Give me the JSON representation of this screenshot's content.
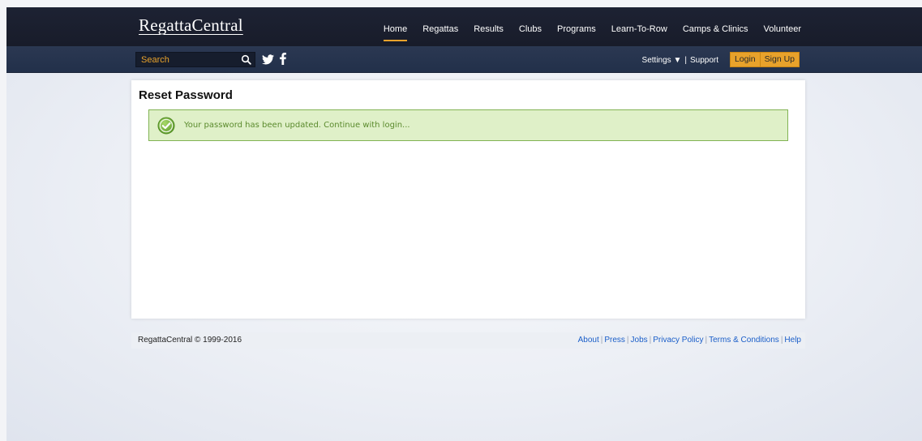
{
  "brand": {
    "logo_part1": "Regatta",
    "logo_part2": "Central"
  },
  "nav": {
    "items": [
      {
        "label": "Home",
        "active": true
      },
      {
        "label": "Regattas"
      },
      {
        "label": "Results"
      },
      {
        "label": "Clubs"
      },
      {
        "label": "Programs"
      },
      {
        "label": "Learn-To-Row"
      },
      {
        "label": "Camps & Clinics"
      },
      {
        "label": "Volunteer"
      }
    ]
  },
  "toolbar": {
    "search_placeholder": "Search",
    "settings_label": "Settings ▼",
    "separator": "|",
    "support_label": "Support",
    "login_label": "Login",
    "signup_label": "Sign Up"
  },
  "main": {
    "title": "Reset Password",
    "alert_text": "Your password has been updated. Continue with login..."
  },
  "footer": {
    "copyright": "RegattaCentral © 1999-2016",
    "links": [
      "About",
      "Press",
      "Jobs",
      "Privacy Policy",
      "Terms & Conditions",
      "Help"
    ]
  },
  "colors": {
    "nav_bg": "#1d2233",
    "accent": "#e8a22b",
    "success_bg": "#dff0c8",
    "success_text": "#5a8a2c",
    "link": "#1a5ec9"
  }
}
